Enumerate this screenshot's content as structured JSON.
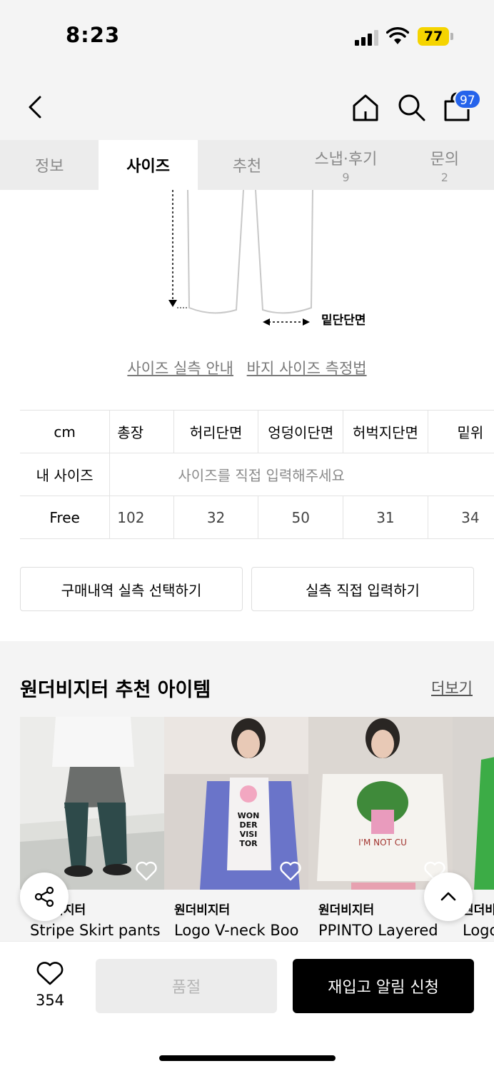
{
  "status": {
    "time": "8:23",
    "battery": "77"
  },
  "header": {
    "cart_count": "97"
  },
  "tabs": [
    {
      "label": "정보",
      "count": ""
    },
    {
      "label": "사이즈",
      "count": ""
    },
    {
      "label": "추천",
      "count": ""
    },
    {
      "label": "스냅·후기",
      "count": "9"
    },
    {
      "label": "문의",
      "count": "2"
    }
  ],
  "diagram": {
    "label": "밑단단면"
  },
  "size_links": {
    "guide": "사이즈 실측 안내",
    "measure": "바지 사이즈 측정법"
  },
  "size_table": {
    "headers": [
      "cm",
      "총장",
      "허리단면",
      "엉덩이단면",
      "허벅지단면",
      "밑위"
    ],
    "my_size_label": "내 사이즈",
    "my_size_placeholder": "사이즈를 직접 입력해주세요",
    "rows": [
      {
        "size": "Free",
        "values": [
          "102",
          "32",
          "50",
          "31",
          "34"
        ]
      }
    ]
  },
  "buttons": {
    "select_purchase": "구매내역 실측 선택하기",
    "direct_input": "실측 직접 입력하기"
  },
  "recommend": {
    "title": "원더비지터 추천 아이템",
    "more": "더보기",
    "items": [
      {
        "brand": "원더비지터",
        "name": "Stripe Skirt pants"
      },
      {
        "brand": "원더비지터",
        "name": "Logo V-neck Boo"
      },
      {
        "brand": "원더비지터",
        "name": "PPINTO Layered"
      },
      {
        "brand": "원더비지터",
        "name": "Logo"
      }
    ]
  },
  "bottom": {
    "like_count": "354",
    "soldout": "품절",
    "restock": "재입고 알림 신청"
  },
  "colors": {
    "accent": "#2563eb",
    "battery": "#f5d400",
    "primary_button": "#000000"
  }
}
